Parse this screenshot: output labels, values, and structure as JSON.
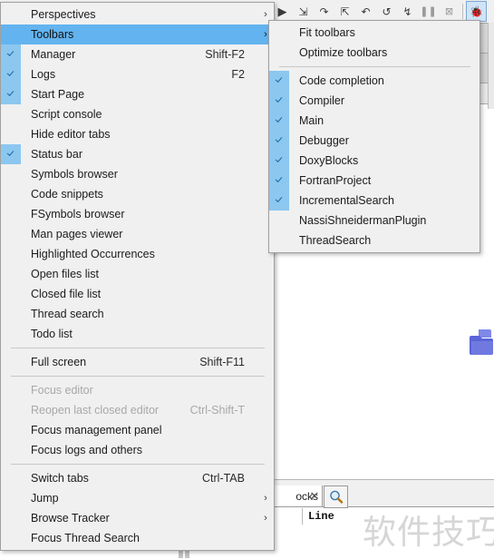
{
  "app": {
    "editor_watermark": "软件技巧",
    "line_label": "Line"
  },
  "toolbar": {
    "buttons": [
      {
        "name": "debug-continue-icon",
        "glyph": "▶"
      },
      {
        "name": "debug-step-into-icon",
        "glyph": "⇲"
      },
      {
        "name": "debug-step-over-icon",
        "glyph": "↷"
      },
      {
        "name": "debug-step-out-icon",
        "glyph": "⇱"
      },
      {
        "name": "debug-next-instruction-icon",
        "glyph": "↶"
      },
      {
        "name": "debug-step-into-instruction-icon",
        "glyph": "↺"
      },
      {
        "name": "debug-run-to-cursor-icon",
        "glyph": "↯"
      },
      {
        "name": "debug-break-icon",
        "glyph": "❚❚"
      },
      {
        "name": "debug-stop-icon",
        "glyph": "⊠"
      },
      {
        "name": "debugging-windows-icon",
        "glyph": "🐞"
      },
      {
        "name": "various-info-icon",
        "glyph": "▮"
      }
    ]
  },
  "view_menu": {
    "name": "view-menu",
    "items": [
      {
        "label": "Perspectives",
        "accel": "",
        "checked": false,
        "submenu": true,
        "selected": false,
        "disabled": false
      },
      {
        "label": "Toolbars",
        "accel": "",
        "checked": false,
        "submenu": true,
        "selected": true,
        "disabled": false
      },
      {
        "label": "Manager",
        "accel": "Shift-F2",
        "checked": true,
        "submenu": false,
        "selected": false,
        "disabled": false
      },
      {
        "label": "Logs",
        "accel": "F2",
        "checked": true,
        "submenu": false,
        "selected": false,
        "disabled": false
      },
      {
        "label": "Start Page",
        "accel": "",
        "checked": true,
        "submenu": false,
        "selected": false,
        "disabled": false
      },
      {
        "label": "Script console",
        "accel": "",
        "checked": false,
        "submenu": false,
        "selected": false,
        "disabled": false
      },
      {
        "label": "Hide editor tabs",
        "accel": "",
        "checked": false,
        "submenu": false,
        "selected": false,
        "disabled": false
      },
      {
        "label": "Status bar",
        "accel": "",
        "checked": true,
        "submenu": false,
        "selected": false,
        "disabled": false
      },
      {
        "label": "Symbols browser",
        "accel": "",
        "checked": false,
        "submenu": false,
        "selected": false,
        "disabled": false
      },
      {
        "label": "Code snippets",
        "accel": "",
        "checked": false,
        "submenu": false,
        "selected": false,
        "disabled": false
      },
      {
        "label": "FSymbols browser",
        "accel": "",
        "checked": false,
        "submenu": false,
        "selected": false,
        "disabled": false
      },
      {
        "label": "Man pages viewer",
        "accel": "",
        "checked": false,
        "submenu": false,
        "selected": false,
        "disabled": false
      },
      {
        "label": "Highlighted Occurrences",
        "accel": "",
        "checked": false,
        "submenu": false,
        "selected": false,
        "disabled": false
      },
      {
        "label": "Open files list",
        "accel": "",
        "checked": false,
        "submenu": false,
        "selected": false,
        "disabled": false
      },
      {
        "label": "Closed file list",
        "accel": "",
        "checked": false,
        "submenu": false,
        "selected": false,
        "disabled": false
      },
      {
        "label": "Thread search",
        "accel": "",
        "checked": false,
        "submenu": false,
        "selected": false,
        "disabled": false
      },
      {
        "label": "Todo list",
        "accel": "",
        "checked": false,
        "submenu": false,
        "selected": false,
        "disabled": false
      },
      {
        "separator": true
      },
      {
        "label": "Full screen",
        "accel": "Shift-F11",
        "checked": false,
        "submenu": false,
        "selected": false,
        "disabled": false
      },
      {
        "separator": true
      },
      {
        "label": "Focus editor",
        "accel": "",
        "checked": false,
        "submenu": false,
        "selected": false,
        "disabled": true
      },
      {
        "label": "Reopen last closed editor",
        "accel": "Ctrl-Shift-T",
        "checked": false,
        "submenu": false,
        "selected": false,
        "disabled": true
      },
      {
        "label": "Focus management panel",
        "accel": "",
        "checked": false,
        "submenu": false,
        "selected": false,
        "disabled": false
      },
      {
        "label": "Focus logs and others",
        "accel": "",
        "checked": false,
        "submenu": false,
        "selected": false,
        "disabled": false
      },
      {
        "separator": true
      },
      {
        "label": "Switch tabs",
        "accel": "Ctrl-TAB",
        "checked": false,
        "submenu": false,
        "selected": false,
        "disabled": false
      },
      {
        "label": "Jump",
        "accel": "",
        "checked": false,
        "submenu": true,
        "selected": false,
        "disabled": false
      },
      {
        "label": "Browse Tracker",
        "accel": "",
        "checked": false,
        "submenu": true,
        "selected": false,
        "disabled": false
      },
      {
        "label": "Focus Thread Search",
        "accel": "",
        "checked": false,
        "submenu": false,
        "selected": false,
        "disabled": false
      }
    ]
  },
  "toolbars_submenu": {
    "name": "toolbars-submenu",
    "items": [
      {
        "label": "Fit toolbars",
        "accel": "",
        "checked": false,
        "submenu": false,
        "selected": false,
        "disabled": false
      },
      {
        "label": "Optimize toolbars",
        "accel": "",
        "checked": false,
        "submenu": false,
        "selected": false,
        "disabled": false
      },
      {
        "separator": true
      },
      {
        "label": "Code completion",
        "accel": "",
        "checked": true,
        "submenu": false,
        "selected": false,
        "disabled": false
      },
      {
        "label": "Compiler",
        "accel": "",
        "checked": true,
        "submenu": false,
        "selected": false,
        "disabled": false
      },
      {
        "label": "Main",
        "accel": "",
        "checked": true,
        "submenu": false,
        "selected": false,
        "disabled": false
      },
      {
        "label": "Debugger",
        "accel": "",
        "checked": true,
        "submenu": false,
        "selected": false,
        "disabled": false
      },
      {
        "label": "DoxyBlocks",
        "accel": "",
        "checked": true,
        "submenu": false,
        "selected": false,
        "disabled": false
      },
      {
        "label": "FortranProject",
        "accel": "",
        "checked": true,
        "submenu": false,
        "selected": false,
        "disabled": false
      },
      {
        "label": "IncrementalSearch",
        "accel": "",
        "checked": true,
        "submenu": false,
        "selected": false,
        "disabled": false
      },
      {
        "label": "NassiShneidermanPlugin",
        "accel": "",
        "checked": false,
        "submenu": false,
        "selected": false,
        "disabled": false
      },
      {
        "label": "ThreadSearch",
        "accel": "",
        "checked": false,
        "submenu": false,
        "selected": false,
        "disabled": false
      }
    ]
  },
  "bottom_panel": {
    "tab_label": "ocks",
    "close_glyph": "✕",
    "search_icon": "search-icon"
  },
  "colors": {
    "menu_bg": "#f0f0f0",
    "selected_blue": "#62b3ef",
    "check_blue": "#8cc7ef",
    "check_mark": "#17699f",
    "folder_blue": "#5b64d8"
  }
}
